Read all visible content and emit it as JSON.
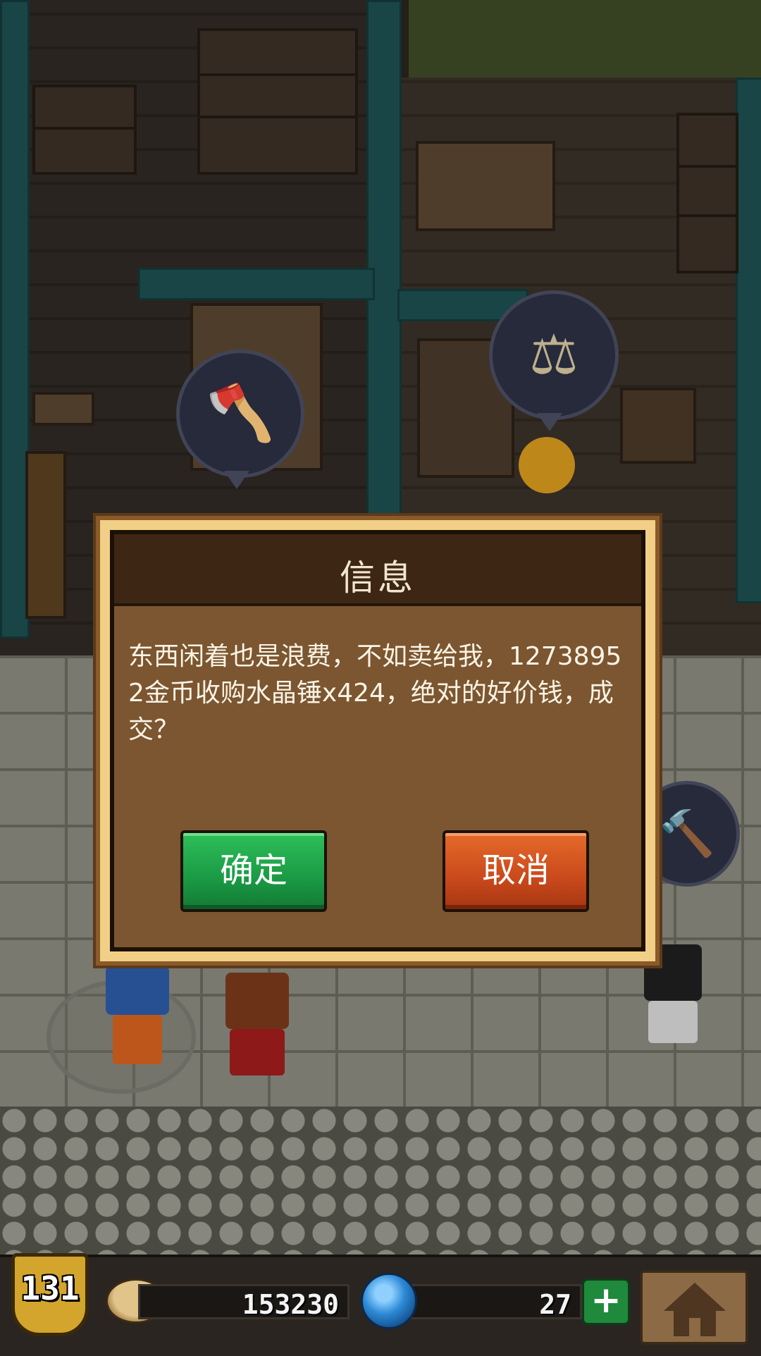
{
  "dialog": {
    "title": "信息",
    "message": "东西闲着也是浪费，不如卖给我，12738952金币收购水晶锤x424，绝对的好价钱，成交？",
    "confirm_label": "确定",
    "cancel_label": "取消"
  },
  "hud": {
    "level": "131",
    "gold": "153230",
    "gems": "27",
    "add_gems_label": "+"
  },
  "scene": {
    "bubble_icons": [
      "axe-icon",
      "scale-icon",
      "hammer-icon"
    ],
    "icons": {
      "axe": "🪓",
      "scale": "⚖",
      "hammer": "🔨"
    }
  },
  "colors": {
    "confirm": "#1a9a44",
    "cancel": "#c9491b",
    "dialog_frame": "#f2cf86",
    "dialog_body": "#7b5631"
  }
}
